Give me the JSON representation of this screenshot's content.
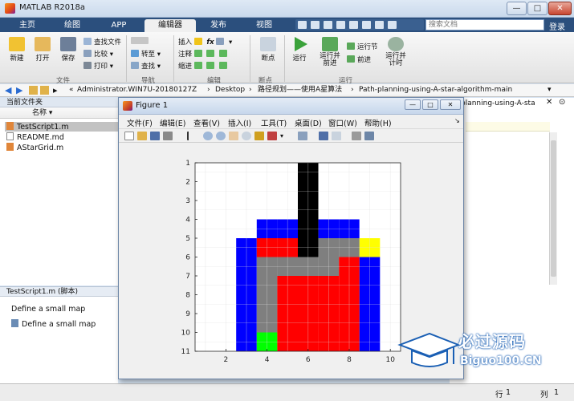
{
  "window": {
    "title": "MATLAB R2018a",
    "min": "—",
    "max": "□",
    "close": "✕"
  },
  "ribbon_tabs": [
    "主页",
    "绘图",
    "APP",
    "编辑器",
    "发布",
    "视图"
  ],
  "search_placeholder": "搜索文档",
  "login": "登录",
  "ribbon": {
    "new": "新建",
    "open": "打开",
    "save": "保存",
    "find_files": "查找文件",
    "compare": "比较",
    "print": "打印",
    "goto": "转至",
    "find": "查找",
    "insert": "插入",
    "comment": "注释",
    "indent": "缩进",
    "fx": "fx",
    "breakpoints": "断点",
    "run": "运行",
    "run_advance": "运行并\n前进",
    "run_section": "运行节",
    "advance": "前进",
    "run_time": "运行并\n计时",
    "groups": {
      "file": "文件",
      "navigate": "导航",
      "edit": "编辑",
      "breakpoints": "断点",
      "run": "运行"
    }
  },
  "address": {
    "segments": [
      "Administrator.WIN7U-20180127Z",
      "Desktop",
      "路径规划——使用A星算法",
      "Path-planning-using-A-star-algorithm-main"
    ]
  },
  "current_folder": {
    "title": "当前文件夹",
    "column": "名称",
    "files": [
      {
        "name": "TestScript1.m",
        "selected": true
      },
      {
        "name": "README.md",
        "selected": false
      },
      {
        "name": "AStarGrid.m",
        "selected": false
      }
    ]
  },
  "details": {
    "title": "TestScript1.m  (脚本)",
    "line1": "Define a small map",
    "line2": "Define a small map"
  },
  "right_panel": {
    "partial_path": "planning-using-A-sta"
  },
  "status": {
    "row_label": "行",
    "row": "1",
    "col_label": "列",
    "col": "1"
  },
  "figure": {
    "title": "Figure 1",
    "menus": [
      "文件(F)",
      "编辑(E)",
      "查看(V)",
      "插入(I)",
      "工具(T)",
      "桌面(D)",
      "窗口(W)",
      "帮助(H)"
    ]
  },
  "chart_data": {
    "type": "heatmap",
    "title": "",
    "xlabel": "",
    "ylabel": "",
    "x_ticks": [
      2,
      4,
      6,
      8,
      10
    ],
    "y_ticks": [
      1,
      2,
      3,
      4,
      5,
      6,
      7,
      8,
      9,
      10,
      11
    ],
    "xlim": [
      0.5,
      10.5
    ],
    "ylim": [
      0.5,
      10.5
    ],
    "grid": true,
    "colors": {
      "W": "#ffffff",
      "K": "#000000",
      "B": "#0000ff",
      "R": "#ff0000",
      "G": "#7f7f7f",
      "Y": "#ffff00",
      "N": "#00ff00"
    },
    "cells": [
      "WWWWWKWWWW",
      "WWWWWKWWWW",
      "WWWWWKWWWW",
      "WWWBBKBBWW",
      "WWBRRKGGYW",
      "WWBGGGGRBW",
      "WWBGRRRRBW",
      "WWBGRRRRBW",
      "WWBGRRRRBW",
      "WWBNRRRRBW"
    ]
  },
  "watermark": {
    "line1": "必过源码",
    "line2": "Biguo100.CN"
  }
}
